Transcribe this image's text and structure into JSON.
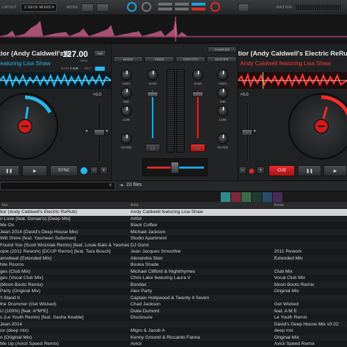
{
  "topbar": {
    "layout_label": "LAYOUT",
    "layout_value": "2 DECK MIXED",
    "mode_label": "MODE",
    "master_label": "MASTER"
  },
  "left_deck": {
    "title": "tior (Andy Caldwell's Electric ReRub)",
    "artist": "featuring Lisa Shaw",
    "bpm": "127.00",
    "bpm_unit": "BPM",
    "tap_label": "TAP",
    "gain_label": "GAIN",
    "gain_value": "0.0dB",
    "key_label": "KEY",
    "pitch_value": "+0.0",
    "sync_label": "SYNC",
    "accent": "#27b9ef"
  },
  "right_deck": {
    "title": "tior (Andy Caldwell's Electric ReRub)",
    "artist": "Andy Caldwell featuring Lisa Shaw",
    "pitch_value": "+0.0",
    "cue_label": "CUE",
    "accent": "#ff3a3a"
  },
  "mixer": {
    "sampler_label": "SAMPLER",
    "tabs": [
      "MIXER",
      "VIDEO",
      "SCRATCH",
      "MASTER"
    ],
    "knob_labels_left": [
      "HIGH",
      "MID",
      "LOW",
      "FILTER"
    ],
    "knob_labels_right": [
      "HIGH",
      "MID",
      "LOW",
      "FILTER"
    ],
    "gain_label": "GAIN"
  },
  "browser": {
    "file_count": "23 files",
    "columns": [
      "Title",
      "Artist",
      "Remix"
    ],
    "rows": [
      {
        "title": "tior (Andy Caldwell's Electric ReRub)",
        "artist": "Andy Caldwell featuring Lisa Shaw",
        "remix": "",
        "selected": true
      },
      {
        "title": "n Love (feat. Donae'o) [Deep Mix]",
        "artist": "Artful",
        "remix": ""
      },
      {
        "title": "Me On",
        "artist": "Black Coffee",
        "remix": ""
      },
      {
        "title": "Jean 2014 (David's Deep House Mix)",
        "artist": "Michael Jackson",
        "remix": ""
      },
      {
        "title": "Will Shine [feat. Yasmeen Sulieman]",
        "artist": "Studio Apartment",
        "remix": ""
      },
      {
        "title": "Found You (Scott Wozniak Remix) [feat. Louie Balo & Yasmeen]",
        "artist": "DJ Gomi",
        "remix": ""
      },
      {
        "title": "ople (2011 Rework) [DCUP Remix] [feat. Tara Busch]",
        "artist": "Jean Jacques Smoothie",
        "remix": "2011 Rework"
      },
      {
        "title": "aroobeat (Extended Mix)",
        "artist": "Alexandra Stan",
        "remix": "Extended Mix"
      },
      {
        "title": "hite Rooms",
        "artist": "Booka Shade",
        "remix": ""
      },
      {
        "title": "ges (Club Mix)",
        "artist": "Michael Clifford & Nightrhymes",
        "remix": "Club Mix"
      },
      {
        "title": "ges (Vocal Club Mix)",
        "artist": "Chris Lake featuring Laura V",
        "remix": "Vocal Club Mix"
      },
      {
        "title": "(Moon Boots Remix)",
        "artist": "Bondax",
        "remix": "Moon Boots Remix"
      },
      {
        "title": "Party (Original Mix)",
        "artist": "Alex Party",
        "remix": "Original Mix"
      },
      {
        "title": "'t Stand It",
        "artist": "Captain Hollywood & Twenty 4 Seven",
        "remix": ""
      },
      {
        "title": "the Drummer (Get Wicked)",
        "artist": "Chad Jackson",
        "remix": "Get Wicked"
      },
      {
        "title": "U (100%) [feat. A*M*E]",
        "artist": "Duke Dumont",
        "remix": "feat. A M E"
      },
      {
        "title": "s (Le Youth Remix) [feat. Sasha Keable]",
        "artist": "Disclosure",
        "remix": "Le Youth Remix"
      },
      {
        "title": "Jean 2014",
        "artist": "",
        "remix": "David's Deep House Mix v0.02"
      },
      {
        "title": "ce (deep mix)",
        "artist": "Migro & Jacob A",
        "remix": "deep mix"
      },
      {
        "title": "n (Original Mix)",
        "artist": "Kenny Ground & Riccardo Fanna",
        "remix": "Original Mix"
      },
      {
        "title": "Me Up (Avicii Speed Remix)",
        "artist": "Avicii",
        "remix": "Avicii Speed Remix"
      }
    ]
  }
}
